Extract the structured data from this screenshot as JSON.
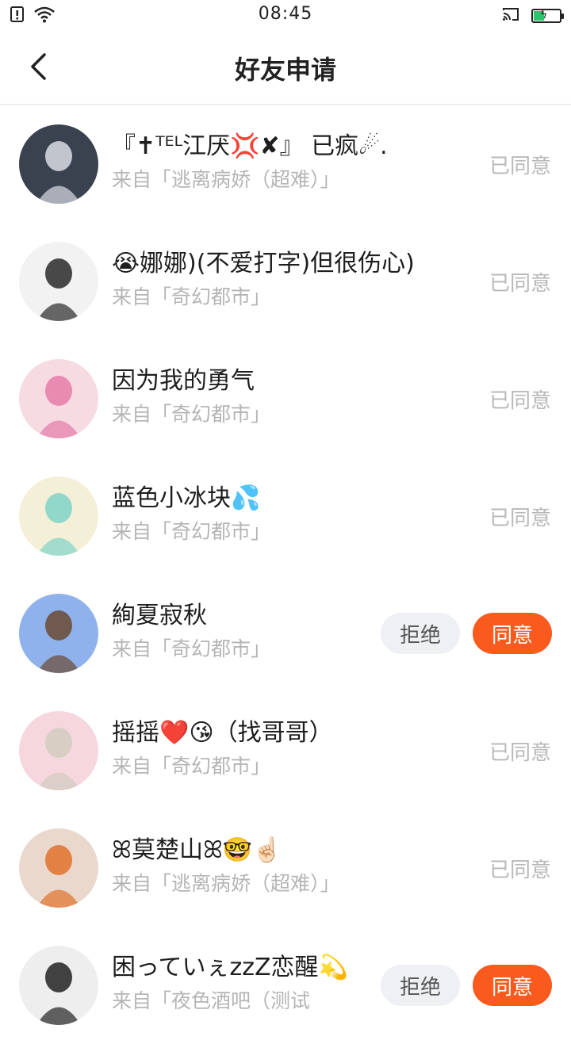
{
  "status_bar": {
    "time": "08:45"
  },
  "header": {
    "title": "好友申请"
  },
  "requests": [
    {
      "name": "『✝ᵀᴱᴸ江厌💢✘』 已疯☄.",
      "source": "来自「逃离病娇（超难）」",
      "state": "accepted",
      "status_label": "已同意",
      "avatar_colors": [
        "#3a4250",
        "#d9dde4"
      ]
    },
    {
      "name": "😭娜娜)(不爱打字)但很伤心)",
      "source": "来自「奇幻都市」",
      "state": "accepted",
      "status_label": "已同意",
      "avatar_colors": [
        "#f2f2f2",
        "#2a2a2a"
      ]
    },
    {
      "name": "因为我的勇气",
      "source": "来自「奇幻都市」",
      "state": "accepted",
      "status_label": "已同意",
      "avatar_colors": [
        "#f6dbe2",
        "#e67ca8"
      ]
    },
    {
      "name": "蓝色小冰块💦",
      "source": "来自「奇幻都市」",
      "state": "accepted",
      "status_label": "已同意",
      "avatar_colors": [
        "#f4f0d8",
        "#7fd3c8"
      ]
    },
    {
      "name": "絢夏寂秋",
      "source": "来自「奇幻都市」",
      "state": "pending",
      "reject_label": "拒绝",
      "accept_label": "同意",
      "avatar_colors": [
        "#8fb2ec",
        "#6b4a34"
      ]
    },
    {
      "name": "摇摇❤️😘（找哥哥）",
      "source": "来自「奇幻都市」",
      "state": "accepted",
      "status_label": "已同意",
      "avatar_colors": [
        "#f6d7de",
        "#d2ccc0"
      ]
    },
    {
      "name": "ꕤ莫楚山ꕤ🤓☝🏻",
      "source": "来自「逃离病娇（超难）」",
      "state": "accepted",
      "status_label": "已同意",
      "avatar_colors": [
        "#ead8cc",
        "#e0722a"
      ]
    },
    {
      "name": "困っていぇzzZ恋醒💫",
      "source": "来自「夜色酒吧（测试",
      "state": "pending",
      "reject_label": "拒绝",
      "accept_label": "同意",
      "avatar_colors": [
        "#eeeeee",
        "#222222"
      ]
    }
  ]
}
